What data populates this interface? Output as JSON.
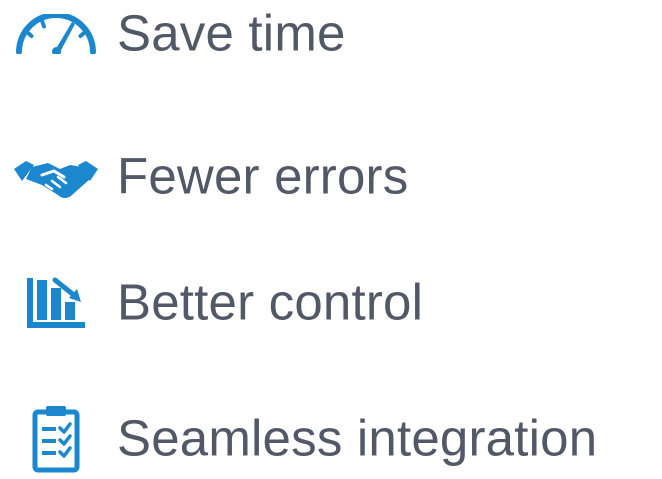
{
  "accent_color": "#1a87cf",
  "text_color": "#525866",
  "benefits": [
    {
      "icon": "speedometer-icon",
      "label": "Save time"
    },
    {
      "icon": "handshake-icon",
      "label": "Fewer errors"
    },
    {
      "icon": "bar-chart-down-icon",
      "label": "Better control"
    },
    {
      "icon": "clipboard-checklist-icon",
      "label": "Seamless integration"
    }
  ]
}
